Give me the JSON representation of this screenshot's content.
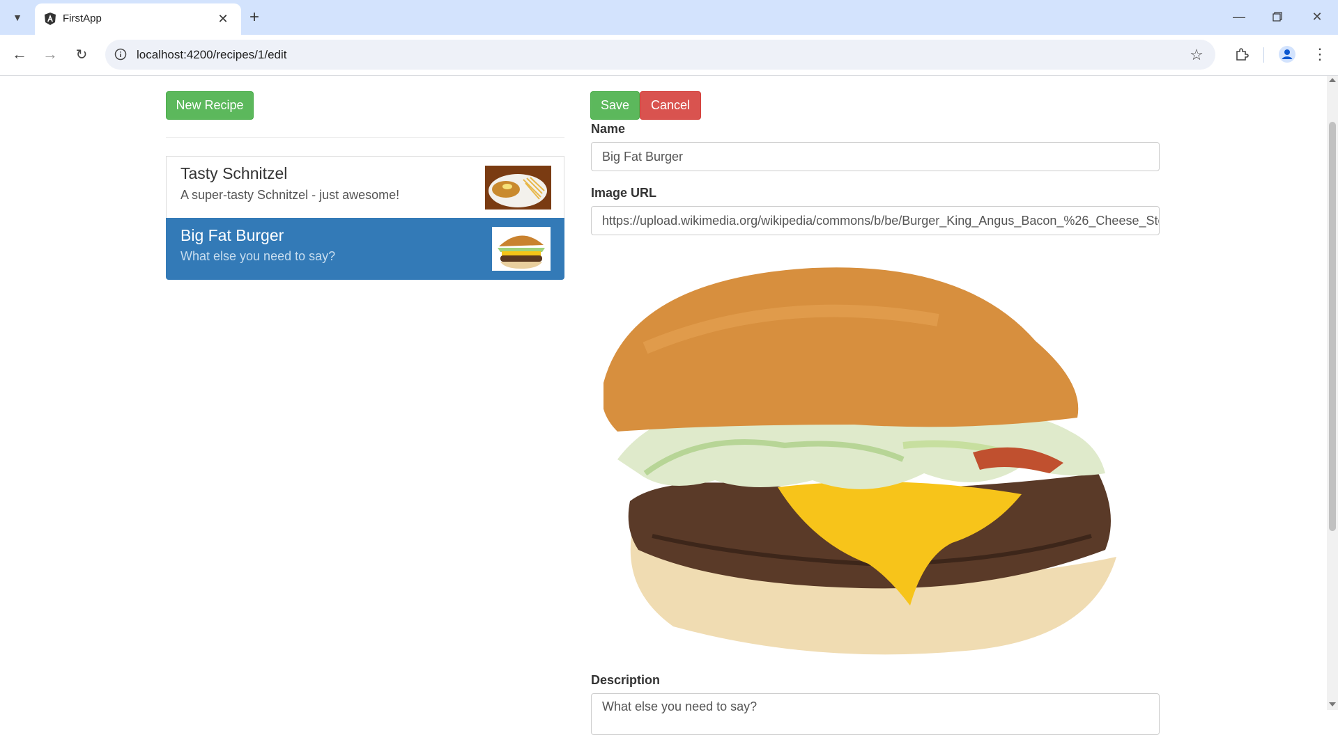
{
  "browser": {
    "tab_title": "FirstApp",
    "url": "localhost:4200/recipes/1/edit",
    "tab_search_icon": "chevron-down-icon",
    "new_tab_icon": "plus-icon"
  },
  "sidebar": {
    "new_recipe_label": "New Recipe",
    "recipes": [
      {
        "name": "Tasty Schnitzel",
        "description": "A super-tasty Schnitzel - just awesome!",
        "active": false
      },
      {
        "name": "Big Fat Burger",
        "description": "What else you need to say?",
        "active": true
      }
    ]
  },
  "editor": {
    "save_label": "Save",
    "cancel_label": "Cancel",
    "name_label": "Name",
    "name_value": "Big Fat Burger",
    "image_url_label": "Image URL",
    "image_url_value": "https://upload.wikimedia.org/wikipedia/commons/b/be/Burger_King_Angus_Bacon_%26_Cheese_Steak_Burger.jpg",
    "description_label": "Description",
    "description_value": "What else you need to say?"
  },
  "colors": {
    "success": "#5cb85c",
    "danger": "#d9534f",
    "active_item": "#337ab7"
  }
}
